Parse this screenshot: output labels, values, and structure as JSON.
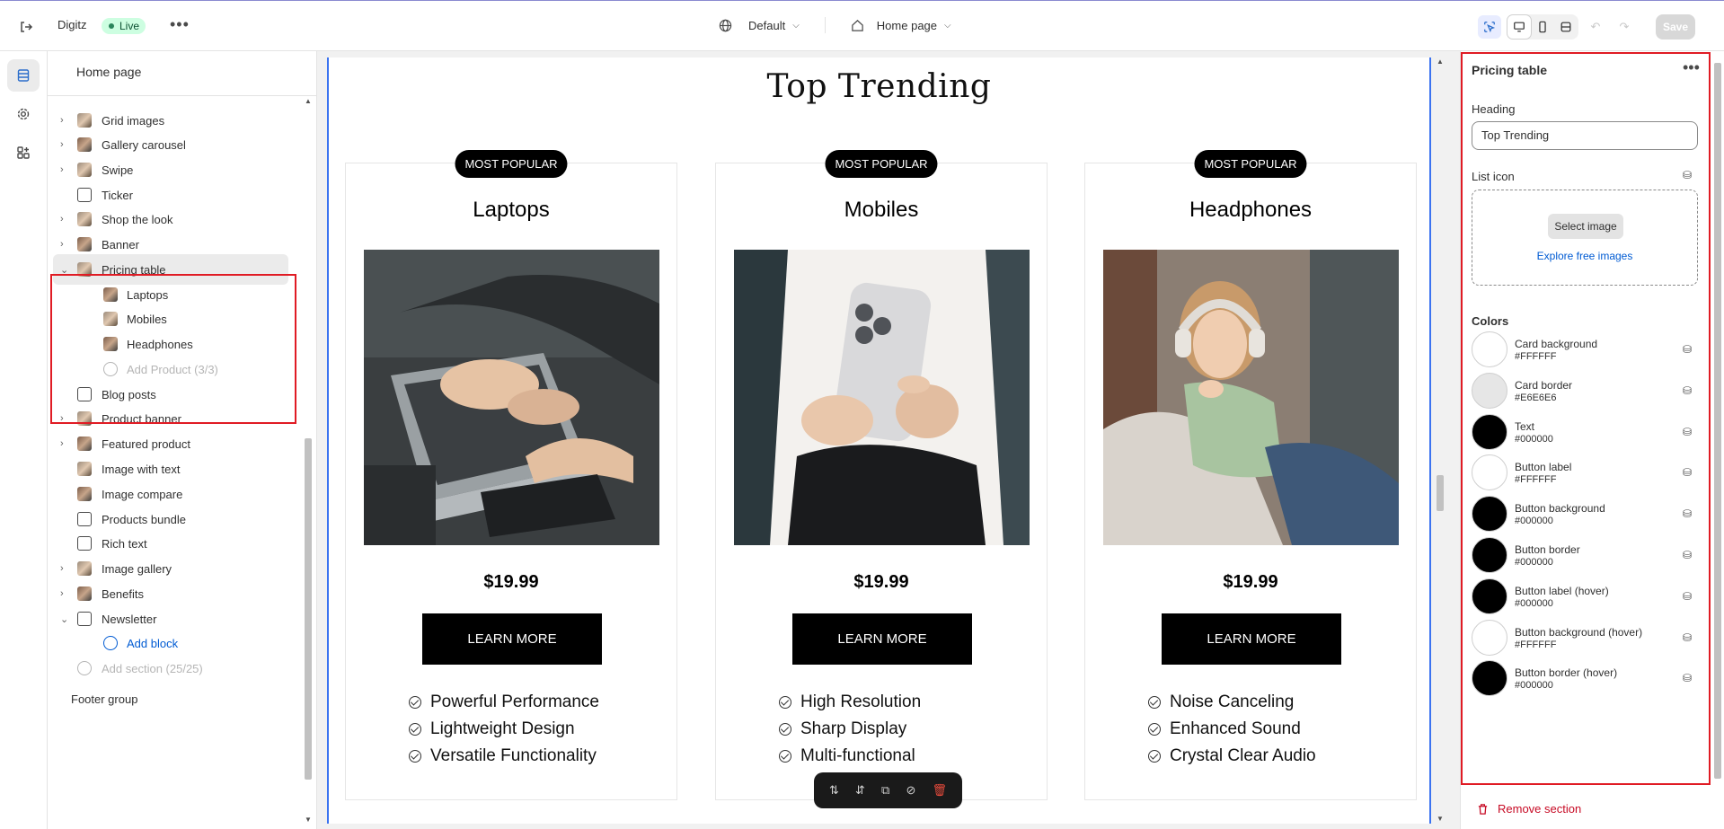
{
  "topbar": {
    "store_name": "Digitz",
    "status_badge": "Live",
    "theme_select": "Default",
    "page_select": "Home page",
    "save_label": "Save"
  },
  "left_panel": {
    "title": "Home page",
    "items": [
      {
        "label": "Grid images",
        "icon": "image-icon",
        "caret": true
      },
      {
        "label": "Gallery carousel",
        "icon": "image-icon",
        "caret": true
      },
      {
        "label": "Swipe",
        "icon": "image-icon",
        "caret": true
      },
      {
        "label": "Ticker",
        "icon": "ticker-icon",
        "caret": false
      },
      {
        "label": "Shop the look",
        "icon": "image-icon",
        "caret": true
      },
      {
        "label": "Banner",
        "icon": "image-icon",
        "caret": true
      },
      {
        "label": "Pricing table",
        "icon": "image-icon",
        "caret": true,
        "expanded": true
      },
      {
        "label": "Laptops",
        "icon": "image-icon",
        "child": true
      },
      {
        "label": "Mobiles",
        "icon": "image-icon",
        "child": true
      },
      {
        "label": "Headphones",
        "icon": "image-icon",
        "child": true
      },
      {
        "label": "Add Product (3/3)",
        "icon": "plus-circle-icon",
        "child": true,
        "muted": true
      },
      {
        "label": "Blog posts",
        "icon": "blog-icon",
        "caret": false
      },
      {
        "label": "Product banner",
        "icon": "image-icon",
        "caret": true
      },
      {
        "label": "Featured product",
        "icon": "image-icon",
        "caret": true
      },
      {
        "label": "Image with text",
        "icon": "image-icon",
        "caret": false
      },
      {
        "label": "Image compare",
        "icon": "image-icon",
        "caret": false
      },
      {
        "label": "Products bundle",
        "icon": "tag-icon",
        "caret": false
      },
      {
        "label": "Rich text",
        "icon": "text-icon",
        "caret": false
      },
      {
        "label": "Image gallery",
        "icon": "image-icon",
        "caret": true
      },
      {
        "label": "Benefits",
        "icon": "image-icon",
        "caret": true
      },
      {
        "label": "Newsletter",
        "icon": "mail-icon",
        "caret": true,
        "expanded": true
      },
      {
        "label": "Add block",
        "icon": "plus-circle-icon",
        "child": true,
        "link": true
      },
      {
        "label": "Add section (25/25)",
        "icon": "plus-circle-icon",
        "muted": true
      },
      {
        "label": "Footer group",
        "icon": "",
        "caret": false
      }
    ]
  },
  "canvas": {
    "heading": "Top Trending",
    "cards": [
      {
        "badge": "MOST POPULAR",
        "name": "Laptops",
        "price": "$19.99",
        "button": "LEARN MORE",
        "features": [
          "Powerful Performance",
          "Lightweight Design",
          "Versatile Functionality"
        ]
      },
      {
        "badge": "MOST POPULAR",
        "name": "Mobiles",
        "price": "$19.99",
        "button": "LEARN MORE",
        "features": [
          "High Resolution",
          "Sharp Display",
          "Multi-functional"
        ]
      },
      {
        "badge": "MOST POPULAR",
        "name": "Headphones",
        "price": "$19.99",
        "button": "LEARN MORE",
        "features": [
          "Noise Canceling",
          "Enhanced Sound",
          "Crystal Clear Audio"
        ]
      }
    ]
  },
  "right_panel": {
    "title": "Pricing table",
    "heading_label": "Heading",
    "heading_value": "Top Trending",
    "list_icon_label": "List icon",
    "select_image": "Select image",
    "explore_images": "Explore free images",
    "colors_heading": "Colors",
    "colors": [
      {
        "name": "Card background",
        "hex": "#FFFFFF",
        "swatch": "#ffffff"
      },
      {
        "name": "Card border",
        "hex": "#E6E6E6",
        "swatch": "#e6e6e6"
      },
      {
        "name": "Text",
        "hex": "#000000",
        "swatch": "#000000"
      },
      {
        "name": "Button label",
        "hex": "#FFFFFF",
        "swatch": "#ffffff"
      },
      {
        "name": "Button background",
        "hex": "#000000",
        "swatch": "#000000"
      },
      {
        "name": "Button border",
        "hex": "#000000",
        "swatch": "#000000"
      },
      {
        "name": "Button label (hover)",
        "hex": "#000000",
        "swatch": "#000000"
      },
      {
        "name": "Button background (hover)",
        "hex": "#FFFFFF",
        "swatch": "#ffffff"
      },
      {
        "name": "Button border (hover)",
        "hex": "#000000",
        "swatch": "#000000"
      }
    ],
    "remove_section": "Remove section"
  }
}
